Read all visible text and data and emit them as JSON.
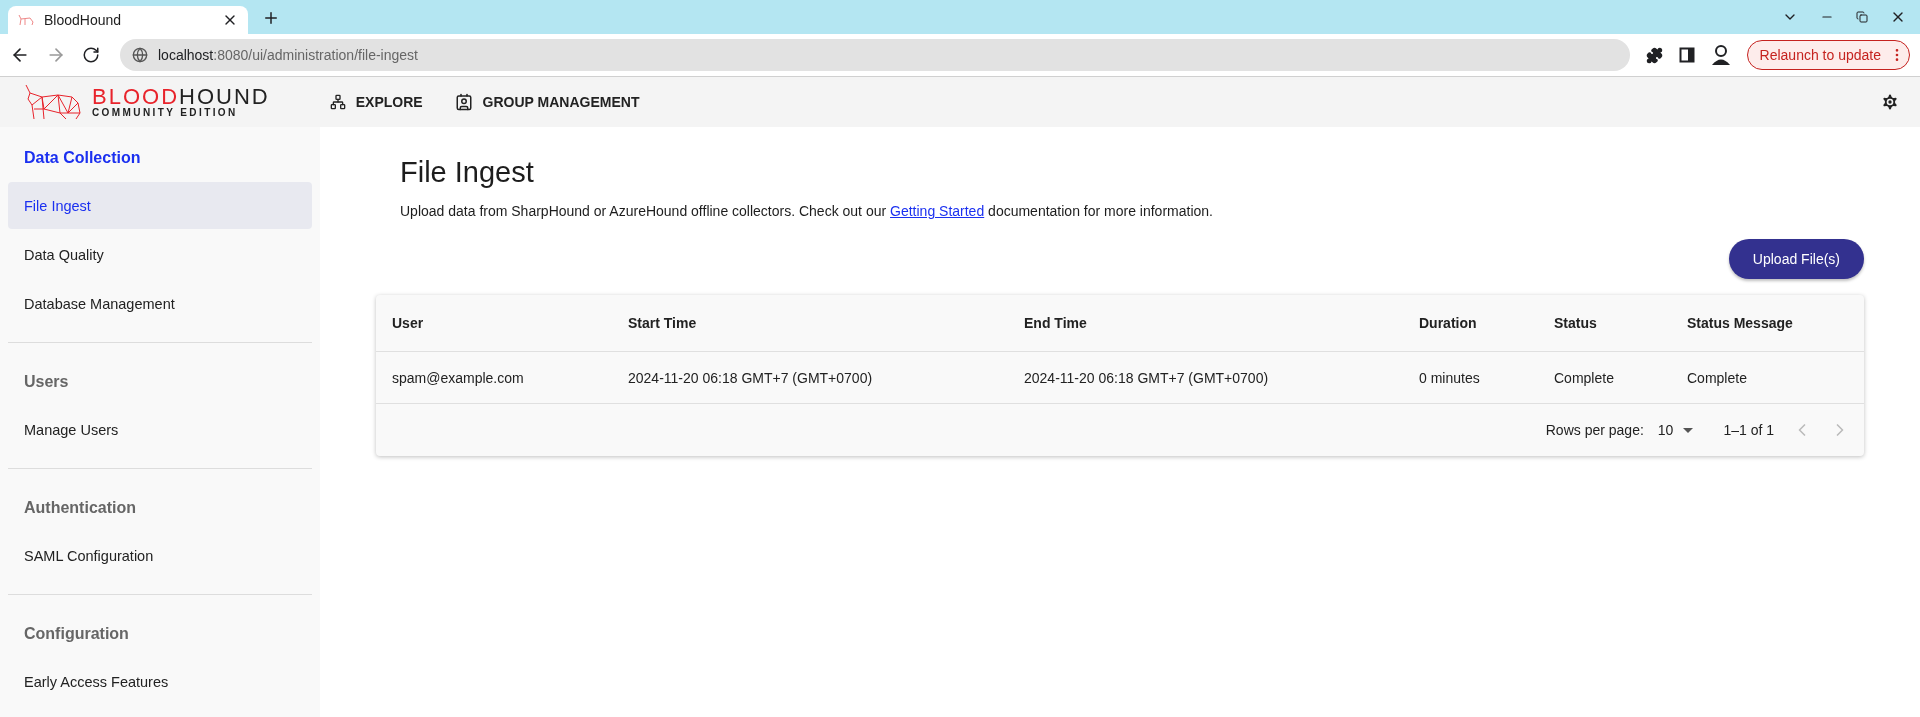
{
  "browser": {
    "tab_title": "BloodHound",
    "url_host": "localhost",
    "url_path": ":8080/ui/administration/file-ingest",
    "relaunch_label": "Relaunch to update"
  },
  "app_header": {
    "logo": {
      "title_parts": [
        "BLOOD",
        "HOUND"
      ],
      "subtitle": "COMMUNITY EDITION"
    },
    "nav": [
      {
        "kind": "explore",
        "label": "EXPLORE"
      },
      {
        "kind": "groups",
        "label": "GROUP MANAGEMENT"
      }
    ]
  },
  "sidebar": {
    "sections": [
      {
        "heading": "Data Collection",
        "items": [
          {
            "label": "File Ingest",
            "selected": true
          },
          {
            "label": "Data Quality",
            "selected": false
          },
          {
            "label": "Database Management",
            "selected": false
          }
        ]
      },
      {
        "heading": "Users",
        "items": [
          {
            "label": "Manage Users",
            "selected": false
          }
        ]
      },
      {
        "heading": "Authentication",
        "items": [
          {
            "label": "SAML Configuration",
            "selected": false
          }
        ]
      },
      {
        "heading": "Configuration",
        "items": [
          {
            "label": "Early Access Features",
            "selected": false
          }
        ]
      }
    ]
  },
  "page": {
    "title": "File Ingest",
    "description_before": "Upload data from SharpHound or AzureHound offline collectors. Check out our ",
    "description_link": "Getting Started",
    "description_after": " documentation for more information.",
    "upload_button": "Upload File(s)"
  },
  "table": {
    "columns": [
      "User",
      "Start Time",
      "End Time",
      "Duration",
      "Status",
      "Status Message"
    ],
    "rows": [
      [
        "spam@example.com",
        "2024-11-20 06:18 GMT+7 (GMT+0700)",
        "2024-11-20 06:18 GMT+7 (GMT+0700)",
        "0 minutes",
        "Complete",
        "Complete"
      ]
    ]
  },
  "pagination": {
    "rows_per_page_label": "Rows per page:",
    "rows_per_page": "10",
    "range": "1–1 of 1",
    "prev_disabled": true,
    "next_disabled": true
  }
}
